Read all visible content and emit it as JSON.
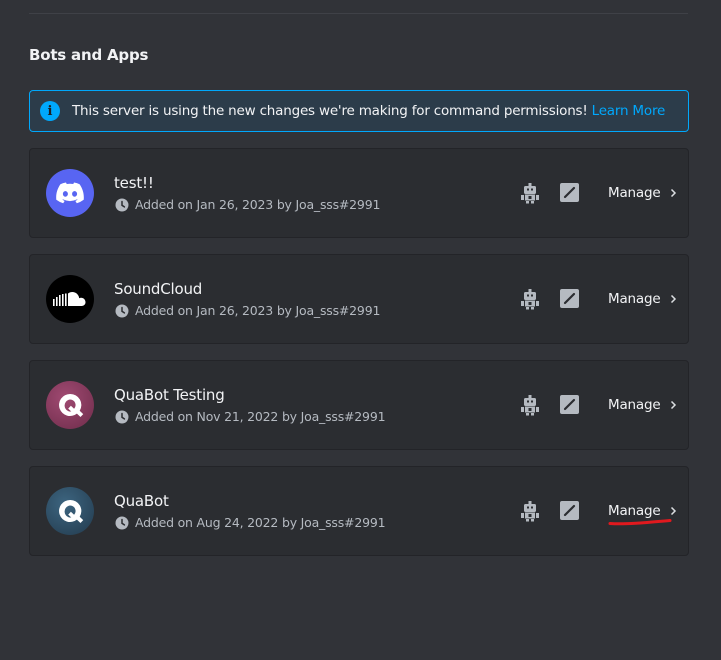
{
  "section": {
    "title": "Bots and Apps"
  },
  "notice": {
    "icon": "info-icon",
    "text": "This server is using the new changes we're making for command permissions!",
    "link": "Learn More",
    "accent": "#00a8fc"
  },
  "apps": [
    {
      "name": "test!!",
      "added": "Added on Jan 26, 2023 by Joa_sss#2991",
      "manage": "Manage",
      "avatar": "discord-logo-icon",
      "avatar_color": "#5865f2"
    },
    {
      "name": "SoundCloud",
      "added": "Added on Jan 26, 2023 by Joa_sss#2991",
      "manage": "Manage",
      "avatar": "soundcloud-logo-icon",
      "avatar_color": "#000000"
    },
    {
      "name": "QuaBot Testing",
      "added": "Added on Nov 21, 2022 by Joa_sss#2991",
      "manage": "Manage",
      "avatar": "quabot-logo-icon",
      "avatar_color": "#8c3b5f"
    },
    {
      "name": "QuaBot",
      "added": "Added on Aug 24, 2022 by Joa_sss#2991",
      "manage": "Manage",
      "avatar": "quabot-logo-icon",
      "avatar_color": "#2f4d64"
    }
  ],
  "annotation": {
    "color": "#e0191e"
  }
}
